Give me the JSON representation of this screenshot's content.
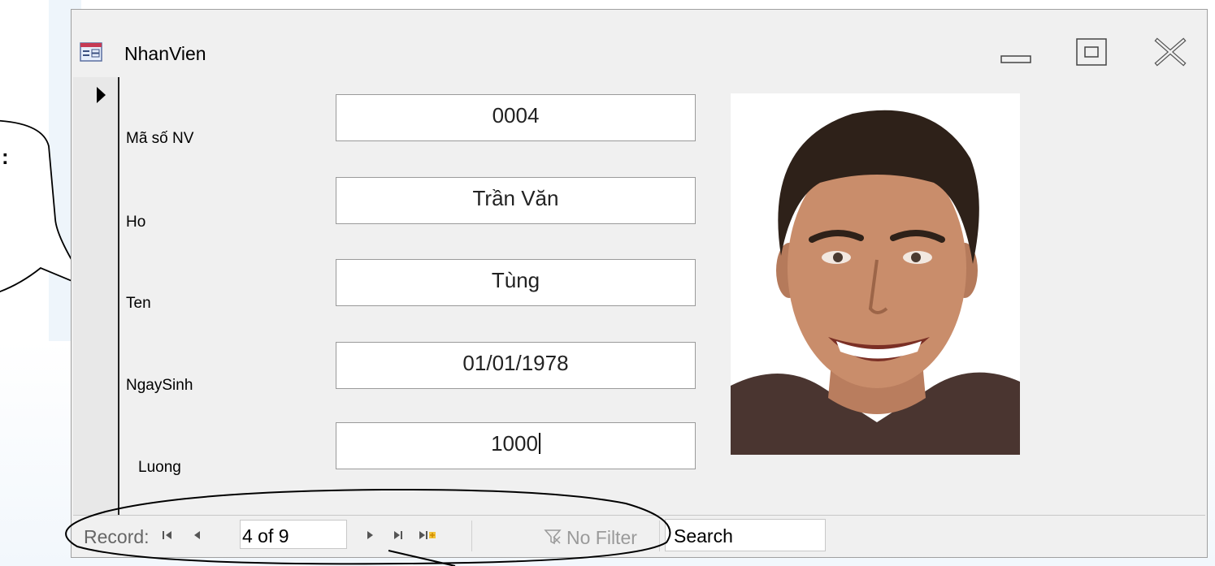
{
  "window": {
    "title": "NhanVien"
  },
  "fields": [
    {
      "label": "Mã số NV",
      "value": "0004"
    },
    {
      "label": "Ho",
      "value": "Trần Văn"
    },
    {
      "label": "Ten",
      "value": "Tùng"
    },
    {
      "label": "NgaySinh",
      "value": "01/01/1978"
    },
    {
      "label": "Luong",
      "value": "1000"
    }
  ],
  "navigation": {
    "record_label": "Record:",
    "current_record": "4 of 9",
    "filter_label": "No Filter",
    "search_value": "Search"
  },
  "callout": {
    "text": ":"
  },
  "icons": {
    "form": "form-view-icon",
    "minimize": "minimize-icon",
    "maximize": "maximize-icon",
    "close": "close-icon",
    "first": "first-record-icon",
    "prev": "previous-record-icon",
    "next": "next-record-icon",
    "last": "last-record-icon",
    "new": "new-record-icon",
    "filter": "no-filter-icon"
  },
  "colors": {
    "window_bg": "#f0f0f0",
    "field_border": "#9a9a9a",
    "disabled_text": "#9a9a9a"
  }
}
